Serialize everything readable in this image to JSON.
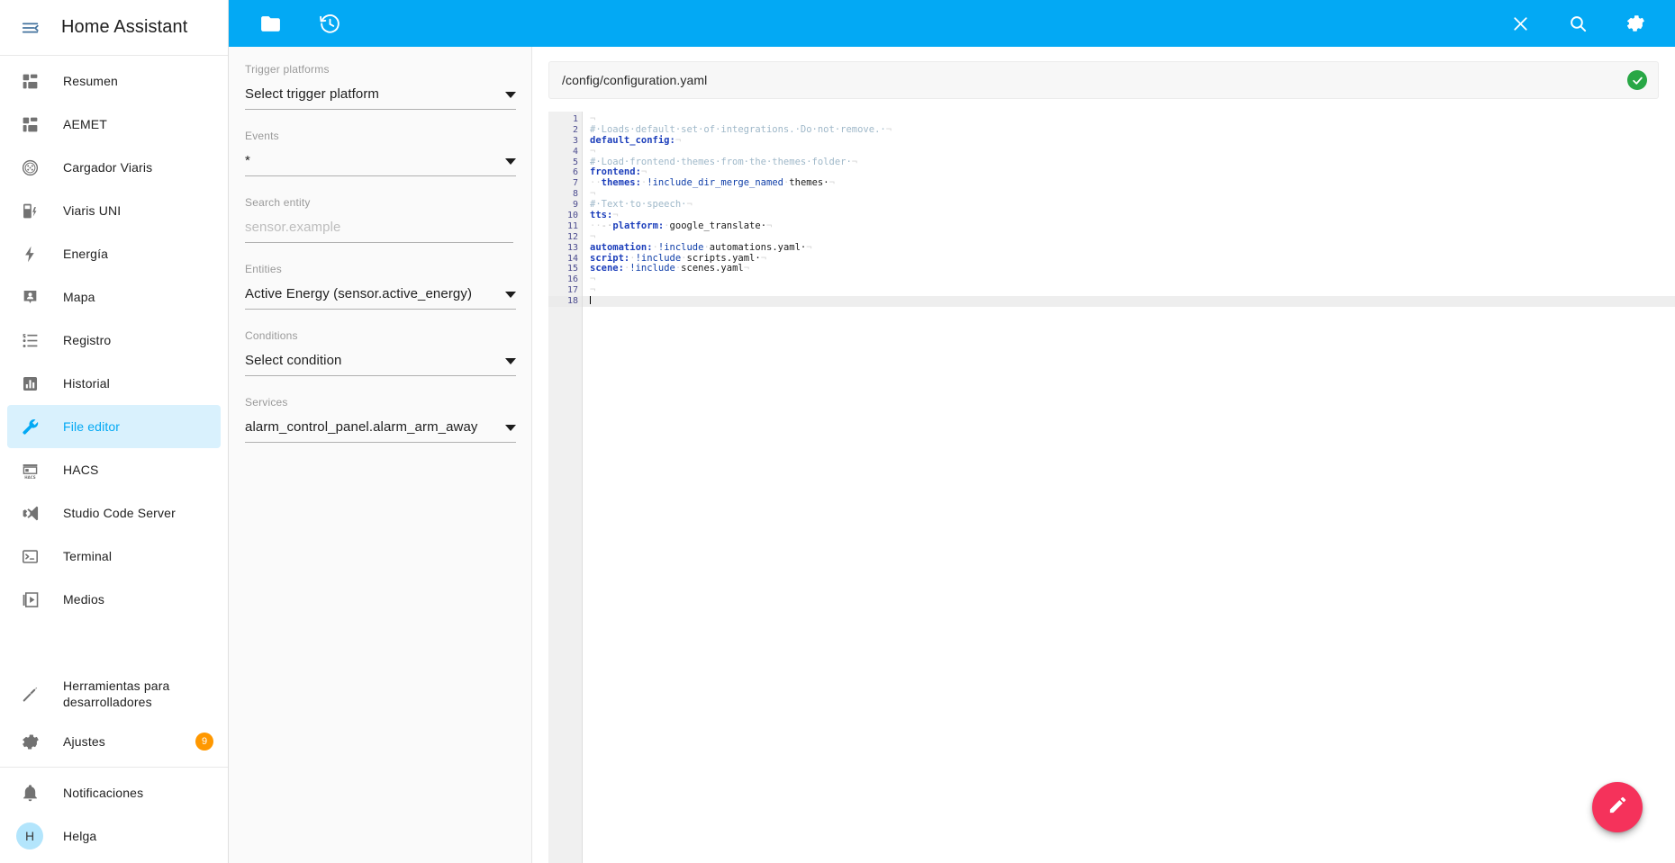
{
  "sidebar": {
    "title": "Home Assistant",
    "menu_icon": "menu-collapse-icon",
    "items": [
      {
        "label": "Resumen",
        "icon": "view-dashboard-icon"
      },
      {
        "label": "AEMET",
        "icon": "view-dashboard-icon"
      },
      {
        "label": "Cargador Viaris",
        "icon": "ev-plug-icon"
      },
      {
        "label": "Viaris UNI",
        "icon": "ev-station-icon"
      },
      {
        "label": "Energía",
        "icon": "lightning-bolt-icon"
      },
      {
        "label": "Mapa",
        "icon": "map-marker-account-icon"
      },
      {
        "label": "Registro",
        "icon": "format-list-icon"
      },
      {
        "label": "Historial",
        "icon": "chart-box-icon"
      },
      {
        "label": "File editor",
        "icon": "wrench-icon"
      },
      {
        "label": "HACS",
        "icon": "hacs-storefront-icon"
      },
      {
        "label": "Studio Code Server",
        "icon": "vscode-icon"
      },
      {
        "label": "Terminal",
        "icon": "console-icon"
      },
      {
        "label": "Medios",
        "icon": "play-box-multiple-icon"
      }
    ],
    "active_item": "File editor",
    "tools": [
      {
        "label": "Herramientas para desarrolladores",
        "icon": "hammer-wrench-icon"
      },
      {
        "label": "Ajustes",
        "icon": "cog-icon",
        "badge": "9"
      }
    ],
    "bottom": [
      {
        "label": "Notificaciones",
        "icon": "bell-icon"
      },
      {
        "label": "Helga",
        "icon": "avatar",
        "avatar_initial": "H"
      }
    ]
  },
  "toolbar": {
    "background": "#03a9f4",
    "left_actions": [
      {
        "name": "browse-filesystem",
        "icon": "folder-icon"
      },
      {
        "name": "restore-backup",
        "icon": "history-restore-icon"
      }
    ],
    "right_actions": [
      {
        "name": "close-file",
        "icon": "close-icon"
      },
      {
        "name": "search-file",
        "icon": "search-icon"
      },
      {
        "name": "settings",
        "icon": "gear-icon"
      }
    ]
  },
  "form": {
    "fields": [
      {
        "label": "Trigger platforms",
        "value": "Select trigger platform",
        "is_placeholder": false,
        "name": "trigger-platform-select"
      },
      {
        "label": "Events",
        "value": "*",
        "is_placeholder": false,
        "name": "events-select"
      },
      {
        "label": "Search entity",
        "value": "sensor.example",
        "is_placeholder": true,
        "name": "search-entity-input"
      },
      {
        "label": "Entities",
        "value": "Active Energy (sensor.active_energy)",
        "is_placeholder": false,
        "name": "entities-select"
      },
      {
        "label": "Conditions",
        "value": "Select condition",
        "is_placeholder": false,
        "name": "conditions-select"
      },
      {
        "label": "Services",
        "value": "alarm_control_panel.alarm_arm_away",
        "is_placeholder": false,
        "name": "services-select"
      }
    ]
  },
  "editor": {
    "path": "/config/configuration.yaml",
    "status_icon": "check-circle-icon",
    "status_color": "#28a745",
    "active_line": 18,
    "total_lines": 18,
    "save_button_icon": "pencil-icon",
    "save_button_color": "#f5325b",
    "lines": [
      {
        "n": 1,
        "fold": false,
        "tokens": [
          {
            "t": "eol",
            "s": "¬"
          }
        ]
      },
      {
        "n": 2,
        "fold": false,
        "tokens": [
          {
            "t": "comment",
            "s": "#·Loads·default·set·of·integrations.·Do·not·remove.·"
          },
          {
            "t": "eol",
            "s": "¬"
          }
        ]
      },
      {
        "n": 3,
        "fold": false,
        "tokens": [
          {
            "t": "key",
            "s": "default_config:"
          },
          {
            "t": "eol",
            "s": "¬"
          }
        ]
      },
      {
        "n": 4,
        "fold": false,
        "tokens": [
          {
            "t": "eol",
            "s": "¬"
          }
        ]
      },
      {
        "n": 5,
        "fold": false,
        "tokens": [
          {
            "t": "comment",
            "s": "#·Load·frontend·themes·from·the·themes·folder·"
          },
          {
            "t": "eol",
            "s": "¬"
          }
        ]
      },
      {
        "n": 6,
        "fold": true,
        "tokens": [
          {
            "t": "key",
            "s": "frontend:"
          },
          {
            "t": "eol",
            "s": "¬"
          }
        ]
      },
      {
        "n": 7,
        "fold": false,
        "tokens": [
          {
            "t": "dot",
            "s": "··"
          },
          {
            "t": "key",
            "s": "themes:"
          },
          {
            "t": "dot",
            "s": "·"
          },
          {
            "t": "bang",
            "s": "!include_dir_merge_named"
          },
          {
            "t": "dot",
            "s": "·"
          },
          {
            "t": "str",
            "s": "themes·"
          },
          {
            "t": "eol",
            "s": "¬"
          }
        ]
      },
      {
        "n": 8,
        "fold": false,
        "tokens": [
          {
            "t": "eol",
            "s": "¬"
          }
        ]
      },
      {
        "n": 9,
        "fold": false,
        "tokens": [
          {
            "t": "comment",
            "s": "#·Text·to·speech·"
          },
          {
            "t": "eol",
            "s": "¬"
          }
        ]
      },
      {
        "n": 10,
        "fold": true,
        "tokens": [
          {
            "t": "key",
            "s": "tts:"
          },
          {
            "t": "eol",
            "s": "¬"
          }
        ]
      },
      {
        "n": 11,
        "fold": false,
        "tokens": [
          {
            "t": "dot",
            "s": "··"
          },
          {
            "t": "dash",
            "s": "-·"
          },
          {
            "t": "key",
            "s": "platform:"
          },
          {
            "t": "dot",
            "s": "·"
          },
          {
            "t": "str",
            "s": "google_translate·"
          },
          {
            "t": "eol",
            "s": "¬"
          }
        ]
      },
      {
        "n": 12,
        "fold": false,
        "tokens": [
          {
            "t": "eol",
            "s": "¬"
          }
        ]
      },
      {
        "n": 13,
        "fold": false,
        "tokens": [
          {
            "t": "key",
            "s": "automation:"
          },
          {
            "t": "dot",
            "s": "·"
          },
          {
            "t": "bang",
            "s": "!include"
          },
          {
            "t": "dot",
            "s": "·"
          },
          {
            "t": "str",
            "s": "automations.yaml·"
          },
          {
            "t": "eol",
            "s": "¬"
          }
        ]
      },
      {
        "n": 14,
        "fold": false,
        "tokens": [
          {
            "t": "key",
            "s": "script:"
          },
          {
            "t": "dot",
            "s": "·"
          },
          {
            "t": "bang",
            "s": "!include"
          },
          {
            "t": "dot",
            "s": "·"
          },
          {
            "t": "str",
            "s": "scripts.yaml·"
          },
          {
            "t": "eol",
            "s": "¬"
          }
        ]
      },
      {
        "n": 15,
        "fold": false,
        "tokens": [
          {
            "t": "key",
            "s": "scene:"
          },
          {
            "t": "dot",
            "s": "·"
          },
          {
            "t": "bang",
            "s": "!include"
          },
          {
            "t": "dot",
            "s": "·"
          },
          {
            "t": "str",
            "s": "scenes.yaml"
          },
          {
            "t": "eol",
            "s": "¬"
          }
        ]
      },
      {
        "n": 16,
        "fold": false,
        "tokens": [
          {
            "t": "eol",
            "s": "¬"
          }
        ]
      },
      {
        "n": 17,
        "fold": false,
        "tokens": [
          {
            "t": "eol",
            "s": "¬"
          }
        ]
      },
      {
        "n": 18,
        "fold": false,
        "tokens": [
          {
            "t": "cursor",
            "s": ""
          }
        ]
      }
    ]
  }
}
